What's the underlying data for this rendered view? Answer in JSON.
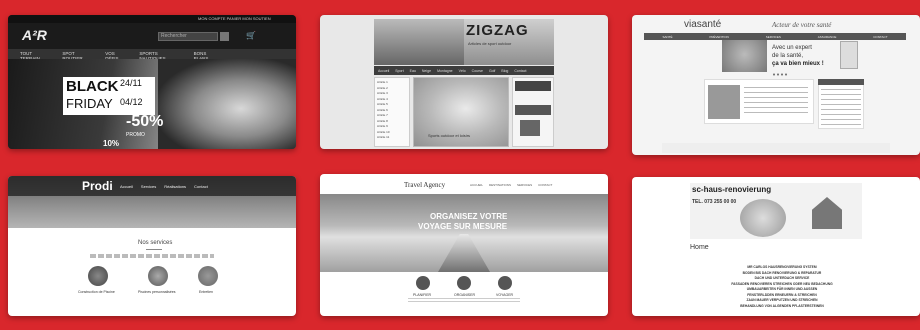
{
  "page": {
    "background": "#d9272c"
  },
  "cards": {
    "c1": {
      "logo": "A²R",
      "topnav": "MON COMPTE  PANIER  MON SOUTIEN",
      "search_placeholder": "Rechercher",
      "menu": [
        "TOUT TERRAIN",
        "SPOT ROUTIER",
        "VOS DÉFIS",
        "SPORTS NAUTIQUES",
        "BONS PLANS"
      ],
      "black": "BLACK",
      "friday": "FRIDAY",
      "date1": "24/11",
      "date2": "04/12",
      "discount": "-50%",
      "promo": "PROMO",
      "corner": "10%"
    },
    "c2": {
      "logo": "ZIGZAG",
      "tagline": "Articles de sport outdoor",
      "nav": [
        "Accueil",
        "Sport",
        "Eau",
        "Neige",
        "Montagne",
        "Vélo",
        "Course",
        "Golf",
        "Blog",
        "Contact"
      ],
      "sidebar_items": [
        "Article 1",
        "Article 2",
        "Article 3",
        "Article 4",
        "Article 5",
        "Article 6",
        "Article 7",
        "Article 8",
        "Article 9",
        "Article 10",
        "Article 11"
      ],
      "caption": "Sports outdoor et loisirs"
    },
    "c3": {
      "logo": "viasanté",
      "slogan": "Acteur de votre santé",
      "nav": [
        "SANTÉ",
        "PRÉVENTION",
        "SERVICES",
        "ASSURANCE",
        "CONTACT"
      ],
      "hero_line1": "Avec un expert",
      "hero_line2": "de la santé,",
      "hero_line3": "ça va bien mieux !"
    },
    "c4": {
      "logo": "Prodi",
      "nav": [
        "Accueil",
        "Services",
        "Réalisations",
        "Contact"
      ],
      "heading": "Nos services",
      "services": [
        "Construction de Piscine",
        "Piscines personnalisées",
        "Entretien"
      ]
    },
    "c5": {
      "logo": "Travel Agency",
      "nav": [
        "ACCUEIL",
        "DESTINATIONS",
        "SERVICES",
        "CONTACT"
      ],
      "hero_line1": "ORGANISEZ VOTRE",
      "hero_line2": "VOYAGE SUR MESURE",
      "features": [
        "PLANIFIER",
        "ORGANISER",
        "VOYAGER"
      ]
    },
    "c6": {
      "logo": "sc-haus-renovierung",
      "tel": "TEL. 073 255 00 00",
      "heading": "Home",
      "list": [
        "MR CARLOS HAUSRENOVIERUNG SYSTEM",
        "BODEN BIS DACH RENOVIERUNG & REPARATUR",
        "DACH UND UNTERDACH SERVICE",
        "FASSADEN RENOVIEREN STREICHEN ODER NEU BEDACHUNG",
        "UMBAUARBEITEN FÜR INNEN UND AUSSEN",
        "FENSTERLÄDEN ERNEUERN & STREICHEN",
        "ZAUN MAUER VERPUTZEN UND STREICHEN",
        "BEHANDLUNG VON ALGENDEN PFLASTERSTEINEN"
      ]
    }
  }
}
